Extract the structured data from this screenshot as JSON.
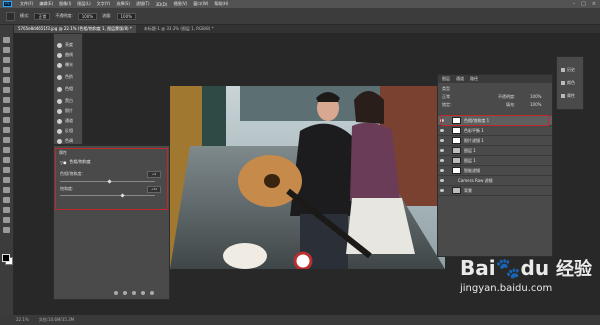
{
  "menubar": {
    "items": [
      "文件(F)",
      "编辑(E)",
      "图像(I)",
      "图层(L)",
      "文字(Y)",
      "选择(S)",
      "滤镜(T)",
      "3D(D)",
      "视图(V)",
      "窗口(W)",
      "帮助(H)"
    ]
  },
  "optionsbar": {
    "mode_label": "模式:",
    "mode_value": "正常",
    "opacity_label": "不透明度:",
    "opacity_value": "100%",
    "flow_label": "流量:",
    "flow_value": "100%"
  },
  "tabs": [
    {
      "label": "5765e8d4651f3.jpg @ 22.1% (色相/饱和度 1, 图层蒙版/8) *"
    },
    {
      "label": "未标题-1 @ 33.3% (图层 1, RGB/8) *"
    }
  ],
  "adjustments": {
    "items": [
      "亮度",
      "曲线",
      "曝光",
      "色阶",
      "色相",
      "黑白",
      "照片",
      "通道",
      "反相",
      "色调"
    ]
  },
  "properties": {
    "title": "属性",
    "subtitle": "色相/饱和度",
    "hue_label": "色相/饱和度:",
    "hue_value": "+9",
    "sat_label": "饱和度:",
    "sat_value": "+32",
    "hue_level": 0.52,
    "sat_level": 0.66
  },
  "layers": {
    "tab": "图层",
    "tab2": "通道",
    "tab3": "路径",
    "kind_label": "类型",
    "blend_mode": "正常",
    "opacity_label": "不透明度:",
    "opacity_value": "100%",
    "lock_label": "锁定:",
    "fill_label": "填充:",
    "fill_value": "100%",
    "rows": [
      {
        "name": "色相/饱和度 1",
        "selected": true
      },
      {
        "name": "色彩平衡 1",
        "selected": false
      },
      {
        "name": "照片滤镜 1",
        "selected": false
      },
      {
        "name": "图层 1",
        "selected": false
      },
      {
        "name": "图层 1",
        "selected": false
      },
      {
        "name": "智能滤镜",
        "selected": false
      },
      {
        "name": "Camera Raw 滤镜",
        "selected": false
      },
      {
        "name": "背景",
        "selected": false
      }
    ]
  },
  "mini_panel": {
    "items": [
      "历史",
      "颜色",
      "属性"
    ]
  },
  "status": {
    "zoom": "22.1%",
    "doc": "文档:10.6M/35.3M"
  },
  "watermark": {
    "brand": "Bai",
    "brand2": "du",
    "jy": "经验",
    "url": "jingyan.baidu.com"
  },
  "colors": {
    "highlight": "#c0282d",
    "ui_bg": "#4a4a4a",
    "canvas_bg": "#282828"
  }
}
